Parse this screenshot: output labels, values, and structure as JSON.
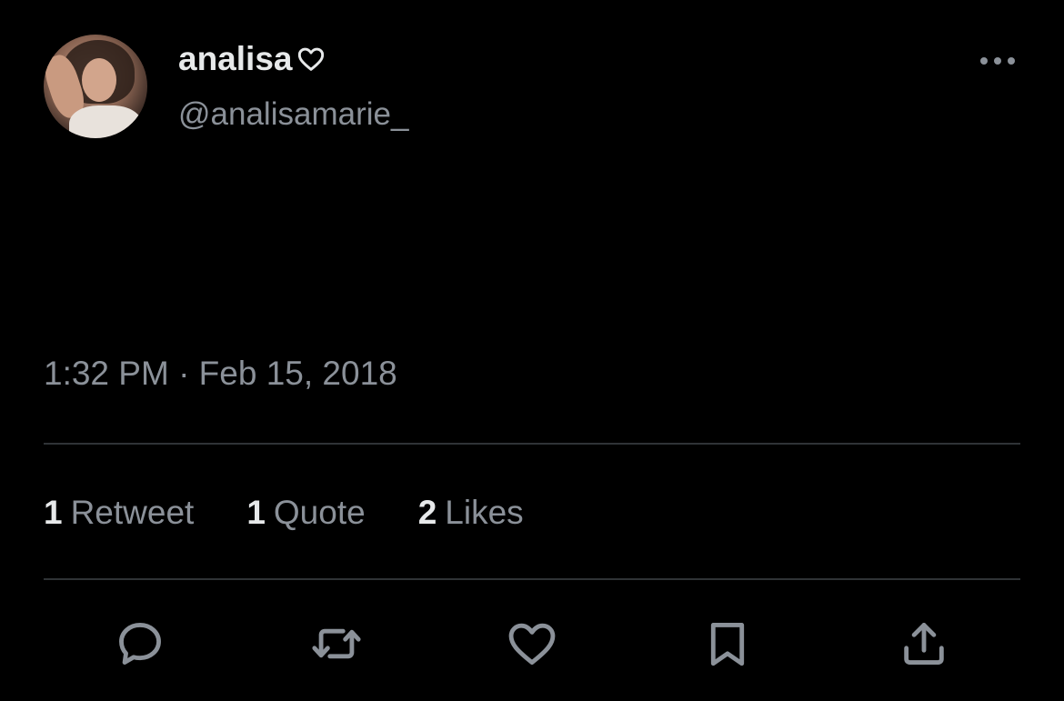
{
  "author": {
    "display_name": "analisa",
    "name_icon": "heart-outline-icon",
    "handle": "@analisamarie_"
  },
  "tweet": {
    "text_line_1": "",
    "text_line_2": "",
    "timestamp": "1:32 PM · Feb 15, 2018"
  },
  "stats": {
    "retweets_count": "1",
    "retweets_label": "Retweet",
    "quotes_count": "1",
    "quotes_label": "Quote",
    "likes_count": "2",
    "likes_label": "Likes"
  },
  "actions": [
    "reply-icon",
    "retweet-icon",
    "like-icon",
    "bookmark-icon",
    "share-icon"
  ],
  "colors": {
    "background": "#000000",
    "primary_text": "#e7e9ea",
    "secondary_text": "#8b9199",
    "divider": "#2f3336"
  }
}
